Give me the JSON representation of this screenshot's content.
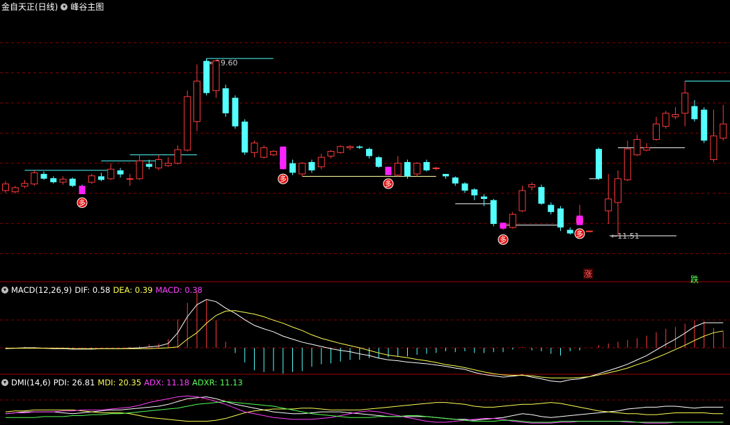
{
  "header": {
    "stock_label": "金自天正(日线)",
    "indicator_label": "峰谷主图"
  },
  "colors": {
    "up": "#ff3b3b",
    "down": "#54ffff",
    "signal": "#ff20ff",
    "grid": "#8b0000",
    "white": "#ffffff",
    "yellow": "#ffff55",
    "green": "#55ff55"
  },
  "macd": {
    "name": "MACD(12,26,9)",
    "dif_label": "DIF: 0.58",
    "dea_label": "DEA: 0.39",
    "macd_label": "MACD: 0.38"
  },
  "dmi": {
    "name": "DMI(14,6)",
    "pdi_label": "PDI: 26.81",
    "mdi_label": "MDI: 20.35",
    "adx_label": "ADX: 11.18",
    "adxr_label": "ADXR: 11.13"
  },
  "chart_data": {
    "type": "candlestick",
    "price_range": [
      10.3,
      21.7
    ],
    "annotations": {
      "high_label": "19.60",
      "low_label": "11.51",
      "zhang": "涨",
      "die": "跌",
      "duo": "多"
    },
    "candles": [
      [
        14.1,
        14.38,
        14.5,
        14.0
      ],
      [
        14.05,
        14.22,
        14.3,
        13.98
      ],
      [
        14.28,
        14.4,
        14.55,
        14.2
      ],
      [
        14.38,
        14.85,
        14.95,
        14.3
      ],
      [
        14.8,
        14.6,
        14.9,
        14.55
      ],
      [
        14.62,
        14.45,
        14.7,
        14.4
      ],
      [
        14.45,
        14.58,
        14.7,
        14.35
      ],
      [
        14.6,
        14.3,
        14.65,
        14.25
      ],
      [
        14.2,
        14.05,
        14.35,
        14.0
      ],
      [
        14.45,
        14.72,
        14.8,
        14.38
      ],
      [
        14.7,
        14.55,
        14.85,
        14.5
      ],
      [
        14.6,
        15.0,
        15.25,
        14.55
      ],
      [
        14.95,
        14.78,
        15.05,
        14.65
      ],
      [
        14.58,
        14.6,
        14.8,
        14.3
      ],
      [
        14.6,
        15.35,
        15.6,
        14.55
      ],
      [
        15.22,
        15.1,
        15.4,
        15.0
      ],
      [
        15.05,
        15.4,
        15.6,
        14.95
      ],
      [
        15.15,
        15.25,
        15.5,
        15.1
      ],
      [
        15.25,
        15.82,
        16.0,
        15.2
      ],
      [
        15.8,
        18.05,
        18.3,
        15.75
      ],
      [
        17.0,
        18.7,
        19.4,
        16.6
      ],
      [
        19.55,
        18.2,
        19.65,
        18.1
      ],
      [
        18.3,
        19.55,
        19.6,
        18.0
      ],
      [
        18.4,
        17.35,
        18.55,
        17.2
      ],
      [
        18.0,
        16.8,
        18.1,
        16.7
      ],
      [
        17.0,
        15.7,
        17.1,
        15.6
      ],
      [
        15.7,
        16.1,
        16.2,
        15.5
      ],
      [
        15.5,
        15.9,
        16.0,
        15.45
      ],
      [
        15.6,
        15.75,
        15.8,
        15.55
      ],
      [
        15.85,
        15.1,
        15.95,
        15.0
      ],
      [
        15.25,
        14.85,
        15.4,
        14.75
      ],
      [
        14.8,
        15.25,
        15.3,
        14.7
      ],
      [
        15.3,
        14.95,
        15.4,
        14.85
      ],
      [
        15.1,
        15.5,
        15.65,
        15.0
      ],
      [
        15.55,
        15.75,
        15.8,
        15.45
      ],
      [
        15.7,
        15.95,
        16.0,
        15.65
      ],
      [
        15.9,
        15.95,
        16.0,
        15.8
      ],
      [
        15.95,
        15.9,
        16.0,
        15.85
      ],
      [
        15.85,
        15.55,
        15.9,
        15.45
      ],
      [
        15.5,
        15.1,
        15.55,
        15.05
      ],
      [
        15.0,
        14.85,
        15.1,
        14.8
      ],
      [
        14.75,
        15.25,
        15.55,
        14.7
      ],
      [
        15.3,
        14.7,
        15.4,
        14.6
      ],
      [
        14.8,
        15.25,
        15.3,
        14.7
      ],
      [
        15.3,
        14.95,
        15.4,
        14.9
      ],
      [
        15.05,
        15.05,
        15.1,
        14.95
      ],
      [
        14.8,
        14.7,
        14.8,
        14.6
      ],
      [
        14.65,
        14.4,
        14.7,
        14.3
      ],
      [
        14.4,
        14.1,
        14.45,
        14.0
      ],
      [
        14.15,
        13.9,
        14.2,
        13.7
      ],
      [
        13.85,
        13.75,
        13.95,
        13.45
      ],
      [
        13.7,
        12.7,
        13.75,
        12.6
      ],
      [
        12.6,
        12.65,
        12.75,
        12.45
      ],
      [
        12.55,
        13.1,
        13.2,
        12.5
      ],
      [
        13.25,
        14.1,
        14.3,
        13.2
      ],
      [
        14.25,
        14.35,
        14.45,
        14.1
      ],
      [
        14.25,
        13.55,
        14.35,
        13.5
      ],
      [
        13.5,
        13.2,
        13.6,
        13.1
      ],
      [
        13.35,
        12.55,
        13.45,
        12.4
      ],
      [
        12.45,
        12.3,
        12.55,
        12.25
      ],
      [
        12.75,
        12.95,
        13.5,
        12.7
      ],
      [
        12.4,
        12.4,
        12.42,
        12.38
      ],
      [
        15.85,
        14.6,
        15.9,
        14.55
      ],
      [
        13.25,
        13.75,
        14.8,
        12.7
      ],
      [
        13.6,
        14.6,
        14.95,
        12.2
      ],
      [
        14.55,
        15.85,
        16.2,
        14.5
      ],
      [
        15.6,
        16.25,
        16.45,
        15.55
      ],
      [
        15.8,
        15.9,
        16.1,
        15.75
      ],
      [
        16.25,
        16.9,
        17.2,
        16.2
      ],
      [
        16.8,
        17.35,
        17.45,
        16.7
      ],
      [
        17.2,
        17.3,
        17.6,
        17.1
      ],
      [
        17.35,
        18.2,
        18.7,
        16.8
      ],
      [
        17.65,
        17.1,
        17.9,
        17.0
      ],
      [
        17.5,
        16.2,
        17.6,
        16.1
      ],
      [
        15.4,
        16.4,
        17.5,
        15.3
      ],
      [
        16.3,
        16.9,
        17.7,
        16.2
      ]
    ],
    "dif": [
      -0.02,
      -0.01,
      0.0,
      0.0,
      -0.01,
      -0.02,
      -0.02,
      -0.03,
      -0.03,
      -0.03,
      -0.02,
      -0.02,
      -0.02,
      -0.01,
      0.0,
      0.02,
      0.04,
      0.1,
      0.35,
      0.72,
      1.0,
      1.12,
      1.07,
      0.92,
      0.8,
      0.65,
      0.52,
      0.44,
      0.37,
      0.27,
      0.2,
      0.13,
      0.08,
      0.03,
      -0.02,
      -0.06,
      -0.09,
      -0.14,
      -0.18,
      -0.24,
      -0.28,
      -0.3,
      -0.33,
      -0.35,
      -0.37,
      -0.4,
      -0.43,
      -0.47,
      -0.5,
      -0.57,
      -0.62,
      -0.65,
      -0.68,
      -0.66,
      -0.63,
      -0.68,
      -0.72,
      -0.77,
      -0.79,
      -0.74,
      -0.72,
      -0.67,
      -0.6,
      -0.53,
      -0.46,
      -0.38,
      -0.28,
      -0.18,
      -0.05,
      0.08,
      0.2,
      0.34,
      0.49,
      0.58,
      0.58,
      0.58
    ],
    "dea": [
      -0.01,
      -0.01,
      -0.01,
      -0.01,
      -0.01,
      -0.01,
      -0.01,
      -0.02,
      -0.02,
      -0.02,
      -0.02,
      -0.02,
      -0.02,
      -0.02,
      -0.02,
      -0.02,
      -0.01,
      0.0,
      0.02,
      0.2,
      0.35,
      0.57,
      0.75,
      0.85,
      0.86,
      0.82,
      0.78,
      0.72,
      0.64,
      0.57,
      0.48,
      0.4,
      0.3,
      0.22,
      0.16,
      0.1,
      0.05,
      0.0,
      -0.06,
      -0.12,
      -0.17,
      -0.2,
      -0.23,
      -0.27,
      -0.3,
      -0.34,
      -0.39,
      -0.42,
      -0.46,
      -0.51,
      -0.56,
      -0.6,
      -0.63,
      -0.64,
      -0.64,
      -0.65,
      -0.68,
      -0.7,
      -0.7,
      -0.7,
      -0.69,
      -0.67,
      -0.63,
      -0.58,
      -0.53,
      -0.47,
      -0.39,
      -0.32,
      -0.23,
      -0.14,
      -0.04,
      0.06,
      0.17,
      0.27,
      0.35,
      0.39
    ],
    "macd_bars": [
      -0.02,
      0.0,
      0.02,
      0.02,
      0.0,
      -0.02,
      -0.02,
      -0.02,
      -0.02,
      -0.02,
      0.0,
      0.0,
      0.0,
      0.02,
      0.04,
      0.08,
      0.1,
      0.2,
      0.66,
      1.04,
      1.3,
      1.1,
      0.64,
      0.14,
      -0.12,
      -0.34,
      -0.52,
      -0.56,
      -0.54,
      -0.6,
      -0.56,
      -0.54,
      -0.44,
      -0.38,
      -0.36,
      -0.32,
      -0.28,
      -0.28,
      -0.24,
      -0.24,
      -0.22,
      -0.2,
      -0.2,
      -0.16,
      -0.14,
      -0.12,
      -0.08,
      -0.1,
      -0.08,
      -0.12,
      -0.12,
      -0.1,
      -0.1,
      -0.04,
      0.02,
      -0.06,
      -0.08,
      -0.14,
      -0.18,
      -0.08,
      -0.06,
      0.0,
      0.06,
      0.1,
      0.14,
      0.18,
      0.22,
      0.28,
      0.36,
      0.44,
      0.48,
      0.56,
      0.64,
      0.62,
      0.46,
      0.38
    ],
    "pdi": [
      20,
      21,
      22,
      22,
      22,
      22,
      21,
      20,
      21,
      22,
      23,
      24,
      24,
      25,
      26,
      27,
      28,
      30,
      33,
      36,
      37,
      38,
      36,
      33,
      30,
      28,
      26,
      24,
      22,
      21,
      20,
      20,
      21,
      22,
      22,
      22,
      21,
      20,
      19,
      18,
      17,
      17,
      17,
      17,
      17,
      16,
      15,
      14,
      14,
      13,
      14,
      15,
      16,
      18,
      20,
      19,
      17,
      16,
      17,
      18,
      19,
      20,
      21,
      22,
      23,
      25,
      26,
      27,
      27,
      28,
      28,
      27,
      26,
      27,
      27,
      27
    ],
    "mdi": [
      22,
      23,
      23,
      24,
      24,
      24,
      24,
      24,
      23,
      22,
      21,
      21,
      21,
      20,
      18,
      16,
      15,
      14,
      13,
      12,
      12,
      12,
      13,
      15,
      18,
      21,
      23,
      24,
      25,
      25,
      25,
      26,
      26,
      25,
      24,
      24,
      24,
      24,
      25,
      26,
      27,
      28,
      29,
      30,
      31,
      32,
      32,
      31,
      30,
      28,
      27,
      27,
      28,
      29,
      30,
      30,
      31,
      32,
      31,
      29,
      27,
      25,
      23,
      22,
      21,
      20,
      20,
      19,
      19,
      20,
      21,
      21,
      21,
      21,
      20,
      20
    ],
    "adx": [
      20,
      21,
      21,
      22,
      22,
      22,
      23,
      23,
      24,
      24,
      24,
      25,
      26,
      27,
      29,
      32,
      34,
      36,
      38,
      39,
      38,
      36,
      33,
      30,
      26,
      22,
      20,
      18,
      16,
      15,
      14,
      14,
      14,
      15,
      16,
      18,
      20,
      22,
      23,
      22,
      20,
      18,
      16,
      14,
      12,
      11,
      11,
      12,
      13,
      14,
      15,
      15,
      14,
      12,
      11,
      10,
      10,
      10,
      11,
      11,
      12,
      12,
      12,
      12,
      12,
      11,
      11,
      10,
      10,
      10,
      11,
      11,
      11,
      11,
      11,
      11
    ],
    "adxr": [
      16,
      16,
      16,
      16,
      17,
      17,
      17,
      18,
      18,
      19,
      19,
      20,
      20,
      21,
      22,
      23,
      24,
      25,
      26,
      28,
      30,
      31,
      32,
      33,
      32,
      31,
      30,
      29,
      28,
      26,
      24,
      22,
      20,
      19,
      18,
      17,
      16,
      16,
      16,
      17,
      17,
      17,
      18,
      18,
      17,
      16,
      15,
      14,
      13,
      12,
      12,
      12,
      13,
      13,
      12,
      11,
      11,
      11,
      12,
      12,
      12,
      12,
      12,
      12,
      12,
      12,
      11,
      11,
      11,
      11,
      11,
      11,
      11,
      11,
      11,
      11
    ]
  }
}
